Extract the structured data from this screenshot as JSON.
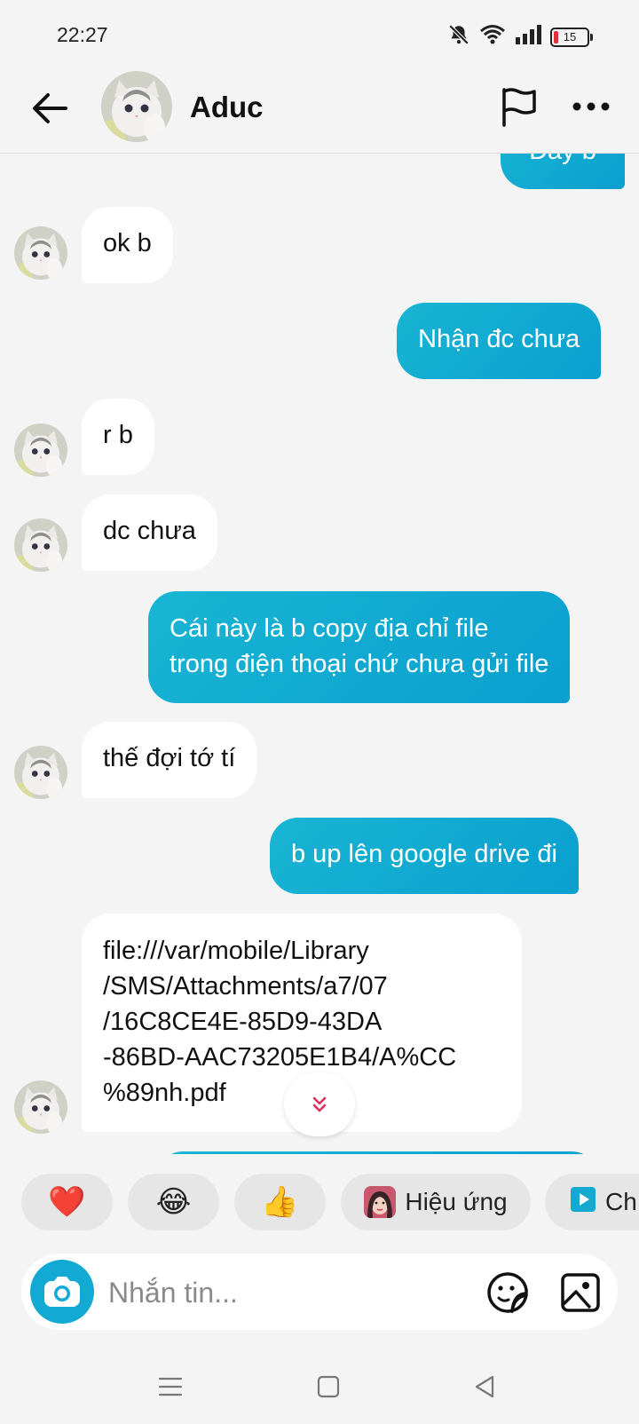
{
  "status_bar": {
    "time": "22:27",
    "battery": "15"
  },
  "header": {
    "contact_name": "Aduc"
  },
  "messages": [
    {
      "dir": "out",
      "text": "Đây b"
    },
    {
      "dir": "in",
      "text": "ok b"
    },
    {
      "dir": "out",
      "text": "Nhận đc chưa"
    },
    {
      "dir": "in",
      "text": "r b"
    },
    {
      "dir": "in",
      "text": "dc chưa"
    },
    {
      "dir": "out",
      "line1": "Cái này là b copy địa chỉ file",
      "line2": "trong điện thoại chứ chưa gửi file"
    },
    {
      "dir": "in",
      "text": "thế đợi tớ tí"
    },
    {
      "dir": "out",
      "text": "b up lên google drive đi"
    },
    {
      "dir": "in",
      "lines": [
        "file:///var/mobile/Library",
        "/SMS/Attachments/a7/07",
        "/16C8CE4E-85D9-43DA",
        "-86BD-AAC73205E1B4/A%CC",
        "%89nh.pdf"
      ]
    }
  ],
  "reactions": [
    {
      "emoji": "❤️"
    },
    {
      "emoji": "😂"
    },
    {
      "emoji": "👍"
    },
    {
      "label": "Hiệu ứng"
    },
    {
      "label": "Ch"
    }
  ],
  "composer": {
    "placeholder": "Nhắn tin..."
  },
  "colors": {
    "accent": "#12a9d3",
    "outgoing_bubble": "#0fa6d1",
    "incoming_bubble": "#ffffff",
    "background": "#f4f4f4"
  }
}
